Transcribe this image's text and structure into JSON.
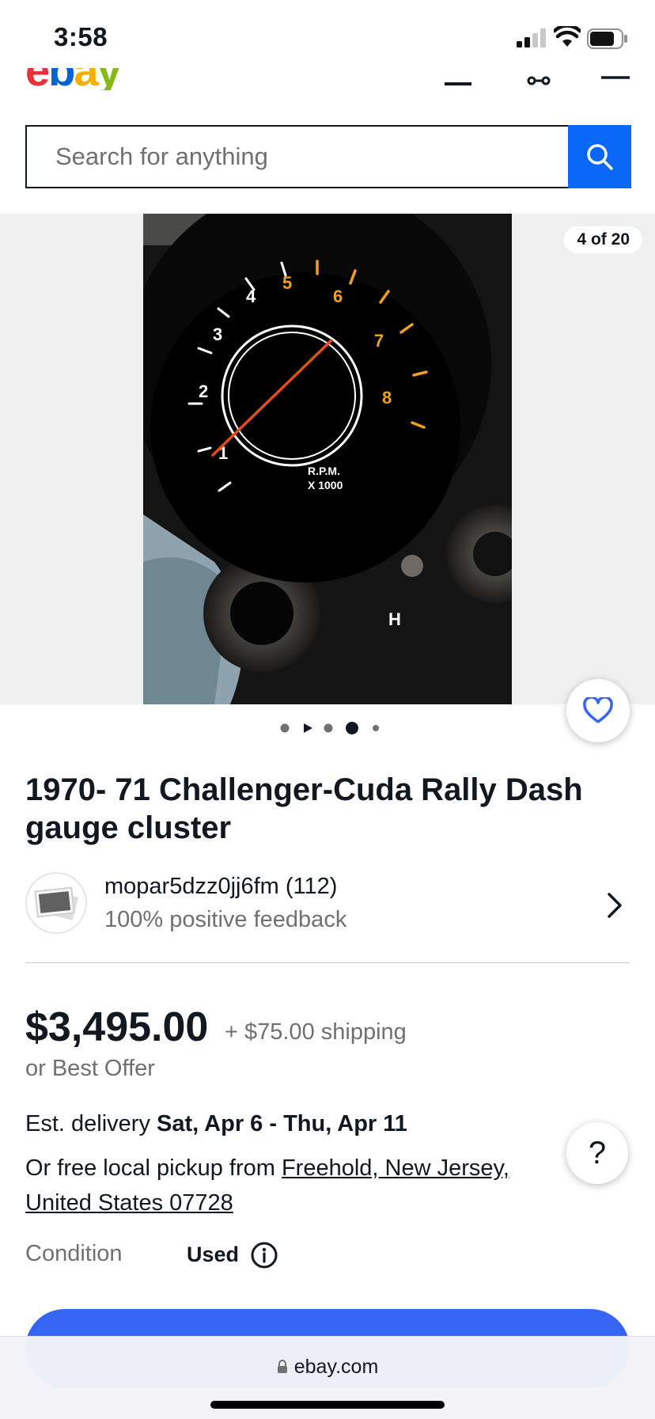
{
  "status_bar": {
    "time": "3:58"
  },
  "header": {
    "logo_letters": [
      "e",
      "b",
      "a",
      "y"
    ]
  },
  "search": {
    "placeholder": "Search for anything"
  },
  "gallery": {
    "counter": "4 of 20",
    "image_alt": "1970- 71 Challenger-Cuda Rally Dash gauge cluster",
    "active_dot": 4,
    "dot_count": 5
  },
  "item": {
    "title": "1970- 71 Challenger-Cuda Rally Dash gauge cluster"
  },
  "seller": {
    "name": "mopar5dzz0jj6fm (112)",
    "feedback": "100% positive feedback"
  },
  "pricing": {
    "price": "$3,495.00",
    "shipping": "+ $75.00 shipping",
    "best_offer": "or Best Offer"
  },
  "delivery": {
    "label": "Est. delivery",
    "dates": "Sat, Apr 6 - Thu, Apr 11",
    "pickup_prefix": "Or free local pickup from",
    "pickup_location": "Freehold, New Jersey, United States 07728"
  },
  "condition": {
    "label": "Condition",
    "value": "Used"
  },
  "help": {
    "label": "?"
  },
  "browser": {
    "url": "ebay.com"
  },
  "colors": {
    "accent": "#0968f6",
    "cta": "#3665f3",
    "text": "#111820",
    "muted": "#707070"
  }
}
